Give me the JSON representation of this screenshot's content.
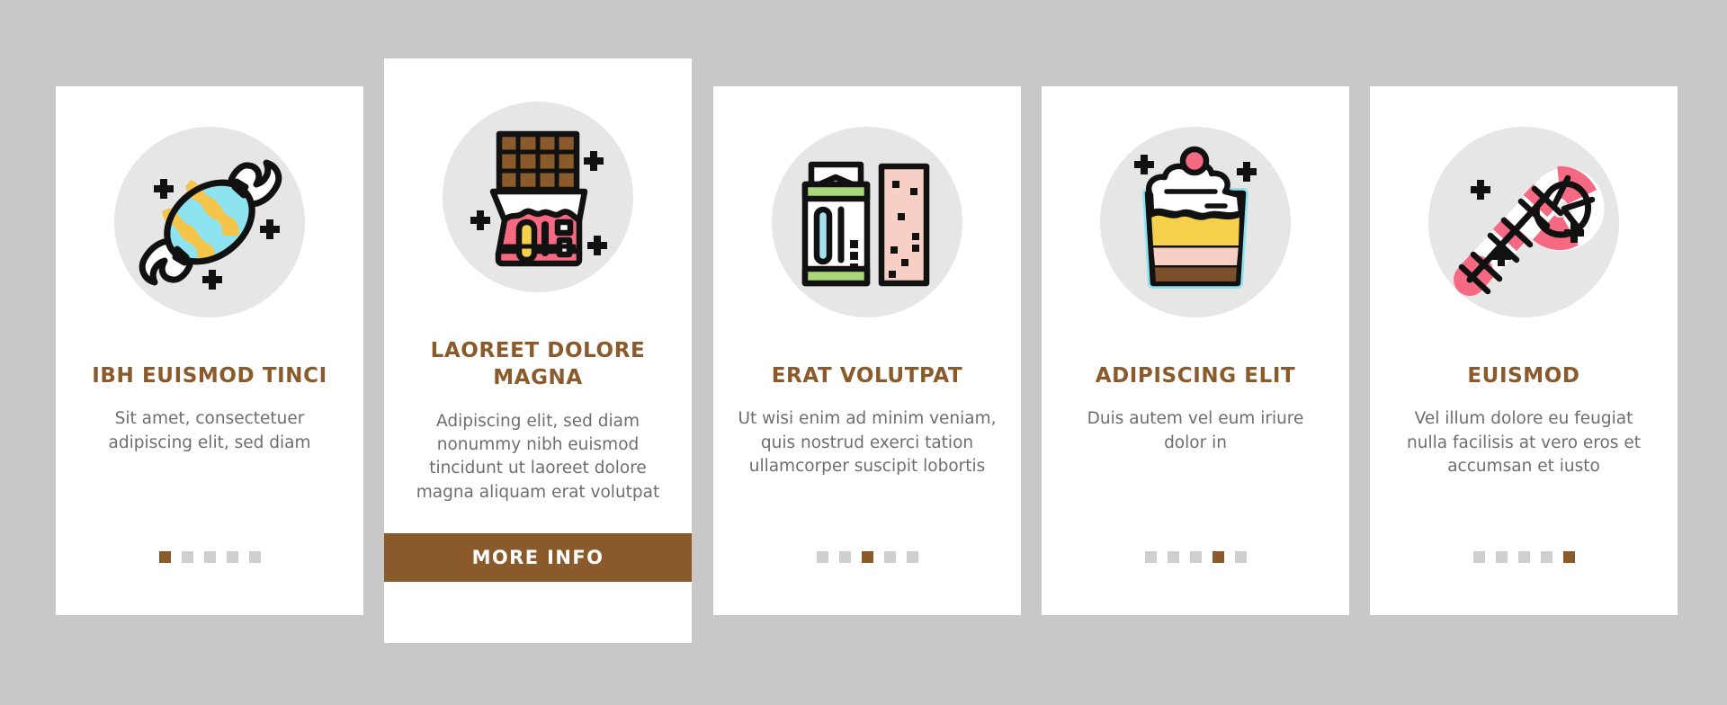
{
  "page": {
    "background_color": "#c8c8c8",
    "card_background": "#ffffff",
    "accent_color": "#8a5a2b",
    "icon_disc_color": "#e6e6e6",
    "title_color": "#8a5a2b",
    "body_text_color": "#6e6e6e",
    "dot_inactive_color": "#cfcfcf"
  },
  "cards": [
    {
      "icon": "wrapped-candy-icon",
      "title": "IBH EUISMOD TINCI",
      "description": "Sit amet, consectetuer adipiscing elit, sed diam",
      "featured": false,
      "dots": {
        "count": 5,
        "active_index": 0
      },
      "cta": null
    },
    {
      "icon": "chocolate-bar-icon",
      "title": "LAOREET DOLORE MAGNA",
      "description": "Adipiscing elit, sed diam nonummy nibh euismod tincidunt ut laoreet dolore magna aliquam erat volutpat",
      "featured": true,
      "dots": null,
      "cta": "MORE INFO"
    },
    {
      "icon": "chewing-gum-icon",
      "title": "ERAT VOLUTPAT",
      "description": "Ut wisi enim ad minim veniam, quis nostrud exerci tation ullamcorper suscipit lobortis",
      "featured": false,
      "dots": {
        "count": 5,
        "active_index": 2
      },
      "cta": null
    },
    {
      "icon": "dessert-parfait-icon",
      "title": "ADIPISCING ELIT",
      "description": "Duis autem vel eum iriure dolor in",
      "featured": false,
      "dots": {
        "count": 5,
        "active_index": 3
      },
      "cta": null
    },
    {
      "icon": "candy-cane-icon",
      "title": "EUISMOD",
      "description": "Vel illum dolore eu feugiat nulla facilisis at vero eros et accumsan et iusto",
      "featured": false,
      "dots": {
        "count": 5,
        "active_index": 4
      },
      "cta": null
    }
  ]
}
